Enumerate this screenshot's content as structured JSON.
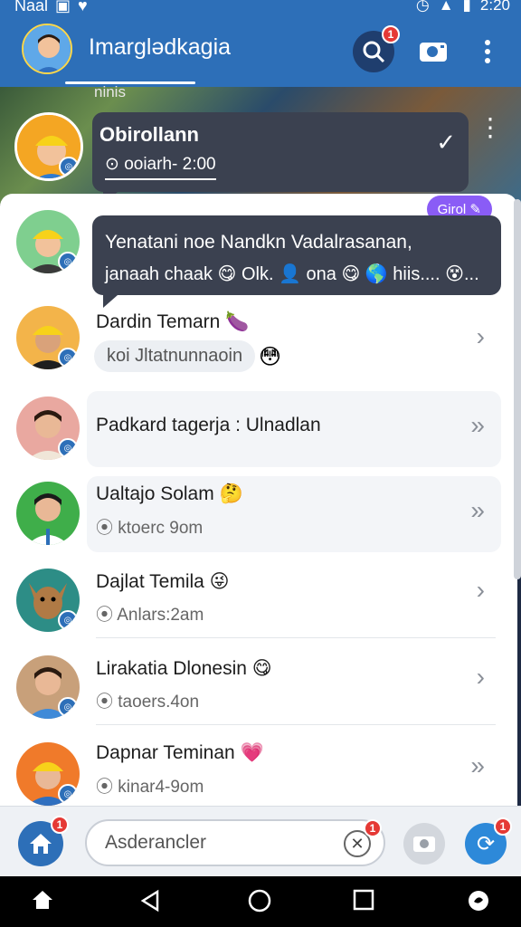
{
  "status_bar": {
    "carrier": "Naal",
    "time": "2:20"
  },
  "header": {
    "title": "Imarglədkagia",
    "search_badge": "1",
    "scene_caption": "ninis"
  },
  "pinned": {
    "name": "Obirollann",
    "subtitle": "⊙ ooiarh- 2:00"
  },
  "tag_pill": "Girol",
  "bubble_message": {
    "line1": "Yenatani noe Nandkn Vadalrasanan,",
    "line2": "janaah chaak 😋 Olk. 👤 ona 😋 🌎 hiis.... 😵..."
  },
  "chats": [
    {
      "name": "Dardin Temarn",
      "emoji": "🍆",
      "subtitle": "koi Jltatnunnaoin",
      "emoji2": "😳"
    },
    {
      "name": "Padkard tagerja : Ulnadlan"
    },
    {
      "name": "Ualtajo Solam",
      "emoji": "🤔",
      "subtitle": "⦿ ktoerc 9om"
    },
    {
      "name": "Dajlat Temila",
      "emoji": "😜",
      "subtitle": "⦿ Anlars:2am"
    },
    {
      "name": "Lirakatia Dlonesin",
      "emoji": "😋",
      "subtitle": "⦿ taoers.4on"
    },
    {
      "name": "Dapnar Teminan",
      "emoji": "💗",
      "subtitle": "⦿ kinar4-9om"
    }
  ],
  "composer": {
    "placeholder": "Asderancler",
    "home_badge": "1",
    "clear_badge": "1",
    "refresh_badge": "1"
  },
  "colors": {
    "primary": "#2d6fb8",
    "bubble": "#3b4150",
    "badge": "#e53935",
    "pill": "#8a5cf6"
  }
}
